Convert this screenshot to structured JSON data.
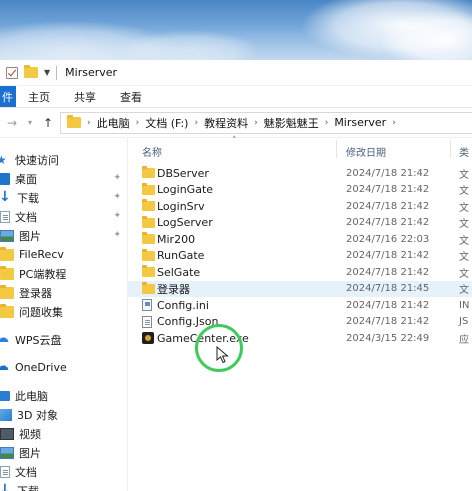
{
  "window": {
    "title": "Mirserver"
  },
  "ribbon": {
    "tabs": [
      "主页",
      "共享",
      "查看"
    ]
  },
  "address": {
    "crumbs": [
      "此电脑",
      "文档 (F:)",
      "教程资料",
      "魅影魁魅王",
      "Mirserver"
    ]
  },
  "nav": {
    "quick_access": "快速访问",
    "pinned": [
      "桌面",
      "下载",
      "文档",
      "图片"
    ],
    "folders": [
      "FileRecv",
      "PC端教程",
      "登录器",
      "问题收集"
    ],
    "wps": "WPS云盘",
    "onedrive": "OneDrive",
    "this_pc": "此电脑",
    "pc_items": [
      "3D 对象",
      "视频",
      "图片",
      "文档",
      "下载"
    ]
  },
  "columns": {
    "name": "名称",
    "date": "修改日期",
    "type": "类"
  },
  "files": [
    {
      "name": "DBServer",
      "date": "2024/7/18 21:42",
      "type": "文",
      "icon": "folder-icon"
    },
    {
      "name": "LoginGate",
      "date": "2024/7/18 21:42",
      "type": "文",
      "icon": "folder-icon"
    },
    {
      "name": "LoginSrv",
      "date": "2024/7/18 21:42",
      "type": "文",
      "icon": "folder-icon"
    },
    {
      "name": "LogServer",
      "date": "2024/7/18 21:42",
      "type": "文",
      "icon": "folder-icon"
    },
    {
      "name": "Mir200",
      "date": "2024/7/16 22:03",
      "type": "文",
      "icon": "folder-icon"
    },
    {
      "name": "RunGate",
      "date": "2024/7/18 21:42",
      "type": "文",
      "icon": "folder-icon"
    },
    {
      "name": "SelGate",
      "date": "2024/7/18 21:42",
      "type": "文",
      "icon": "folder-icon"
    },
    {
      "name": "登录器",
      "date": "2024/7/18 21:45",
      "type": "文",
      "icon": "folder-icon",
      "selected": true
    },
    {
      "name": "Config.ini",
      "date": "2024/7/18 21:42",
      "type": "IN",
      "icon": "ini-file-icon"
    },
    {
      "name": "Config.Json",
      "date": "2024/7/18 21:42",
      "type": "JS",
      "icon": "json-file-icon"
    },
    {
      "name": "GameCenter.exe",
      "date": "2024/3/15 22:49",
      "type": "应",
      "icon": "exe-file-icon"
    }
  ],
  "colors": {
    "accent": "#1a6fd1",
    "selection": "#e5f1fb",
    "cursor_ring": "#3ecb5c",
    "folder": "#f3c843"
  }
}
